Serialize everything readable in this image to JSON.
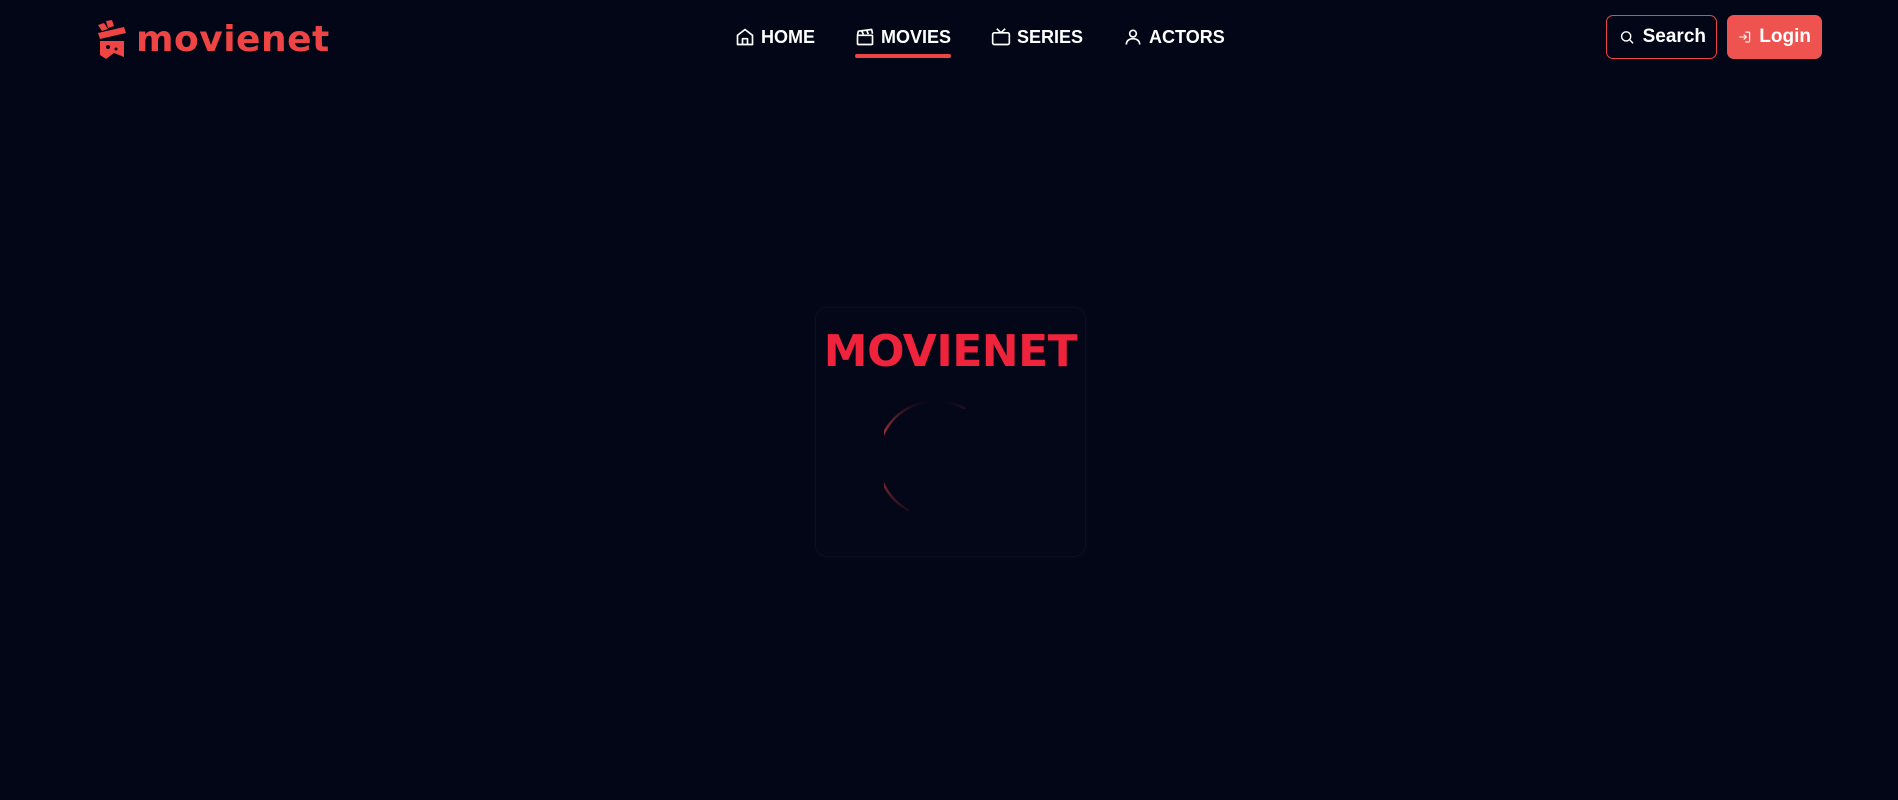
{
  "brand": {
    "name": "movienet",
    "color": "#ef4444",
    "icon": "clapperboard-icon"
  },
  "nav": {
    "items": [
      {
        "label": "HOME",
        "icon": "home-icon",
        "active": false
      },
      {
        "label": "MOVIES",
        "icon": "clapperboard-icon",
        "active": true
      },
      {
        "label": "SERIES",
        "icon": "tv-icon",
        "active": false
      },
      {
        "label": "ACTORS",
        "icon": "user-icon",
        "active": false
      }
    ]
  },
  "actions": {
    "search_label": "Search",
    "search_icon": "search-icon",
    "login_label": "Login",
    "login_icon": "login-icon"
  },
  "loader": {
    "title": "MOVIENET",
    "spinner_icon": "spinner-icon"
  },
  "colors": {
    "background": "#020617",
    "accent": "#ef4444",
    "loader_title": "#ef233c",
    "text": "#ffffff"
  }
}
